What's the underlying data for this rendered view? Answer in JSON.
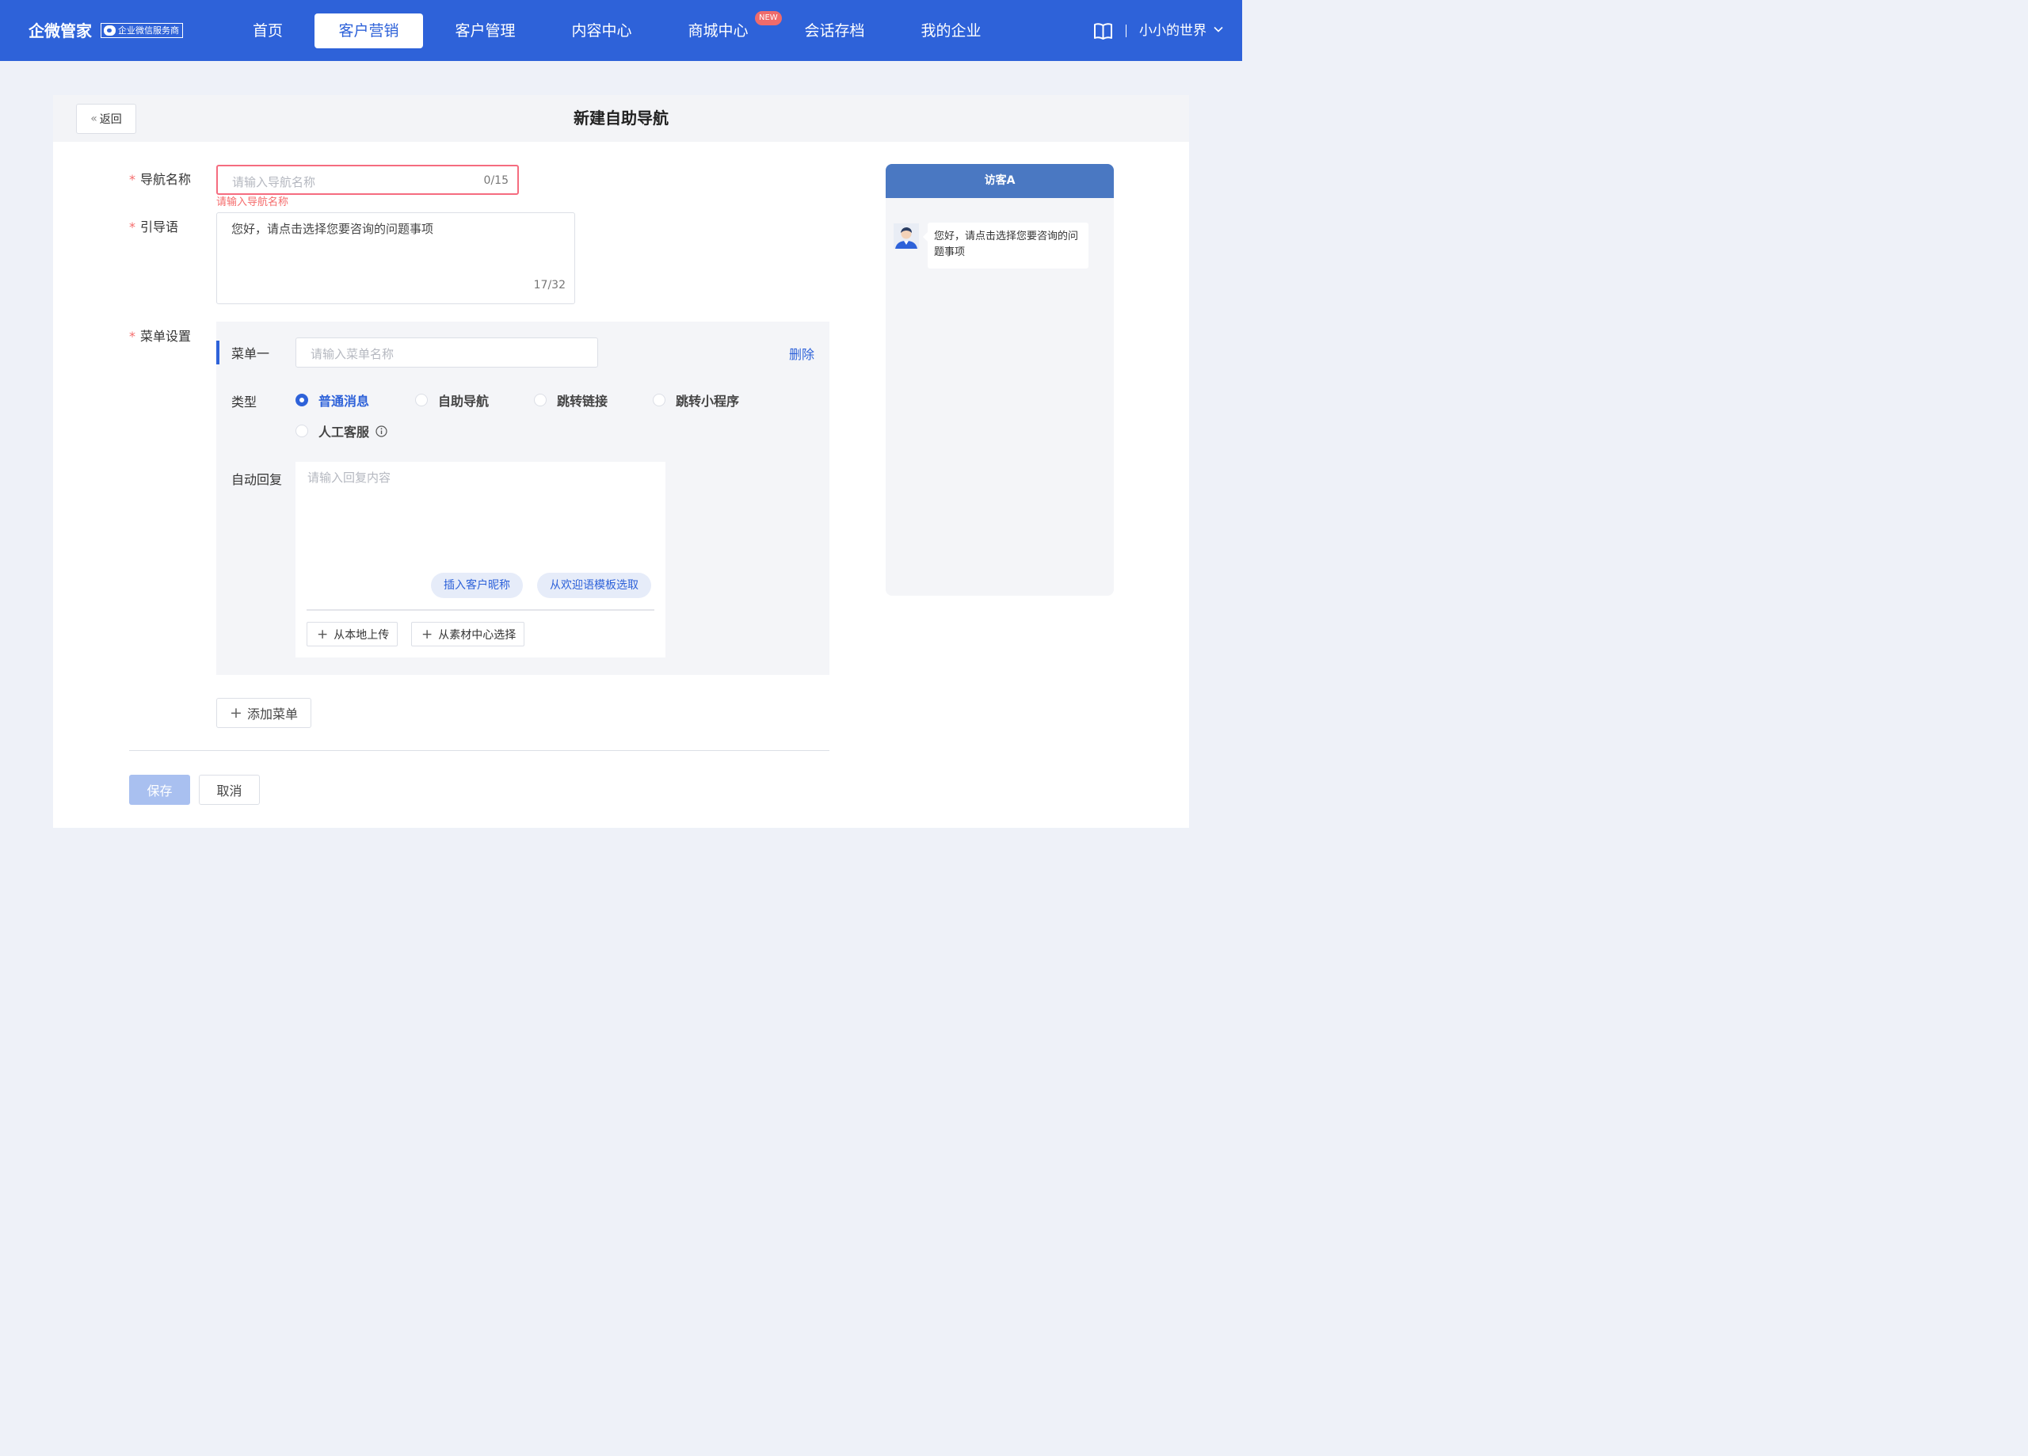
{
  "brand": {
    "name": "企微管家",
    "badge": "企业微信服务商"
  },
  "nav": {
    "items": [
      {
        "label": "首页"
      },
      {
        "label": "客户营销"
      },
      {
        "label": "客户管理"
      },
      {
        "label": "内容中心"
      },
      {
        "label": "商城中心"
      },
      {
        "label": "会话存档"
      },
      {
        "label": "我的企业"
      }
    ],
    "active_index": 1,
    "new_badge": "NEW",
    "user_name": "小小的世界"
  },
  "page": {
    "back_label": "返回",
    "title": "新建自助导航"
  },
  "form": {
    "nav_name": {
      "label": "导航名称",
      "placeholder": "请输入导航名称",
      "value": "",
      "counter": "0/15",
      "error": "请输入导航名称"
    },
    "guide": {
      "label": "引导语",
      "value": "您好，请点击选择您要咨询的问题事项",
      "counter": "17/32"
    },
    "menu_settings": {
      "label": "菜单设置"
    },
    "menu": {
      "title": "菜单一",
      "name_placeholder": "请输入菜单名称",
      "delete_label": "删除",
      "type_label": "类型",
      "types": [
        "普通消息",
        "自助导航",
        "跳转链接",
        "跳转小程序",
        "人工客服"
      ],
      "selected_type": "普通消息",
      "auto_reply_label": "自动回复",
      "reply_placeholder": "请输入回复内容",
      "insert_nickname": "插入客户昵称",
      "from_template": "从欢迎语模板选取",
      "upload_local": "从本地上传",
      "from_material": "从素材中心选择"
    },
    "add_menu": "添加菜单",
    "save": "保存",
    "cancel": "取消"
  },
  "preview": {
    "header": "访客A",
    "message": "您好，请点击选择您要咨询的问题事项"
  },
  "colors": {
    "primary": "#2e62d9",
    "error": "#f56c6c",
    "preview_header": "#4a78c2"
  }
}
